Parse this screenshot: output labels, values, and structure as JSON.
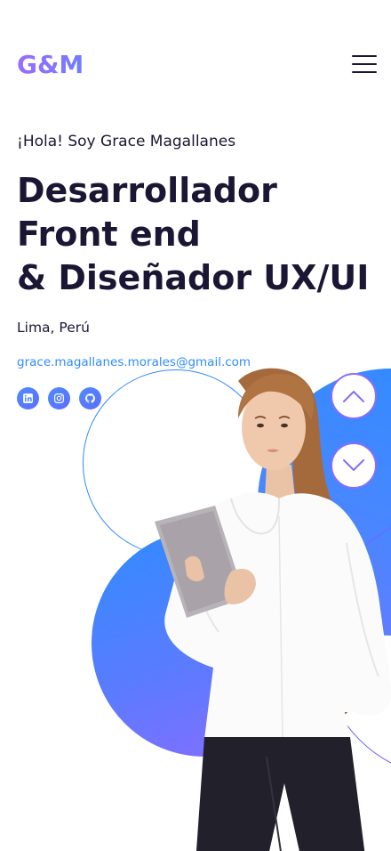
{
  "header": {
    "logo": "G&M",
    "menu_icon": "hamburger-menu-icon"
  },
  "intro": {
    "greeting": "¡Hola! Soy Grace Magallanes",
    "headline": [
      "Desarrollador",
      "Front end",
      "& Diseñador UX/UI"
    ],
    "location": "Lima, Perú",
    "email": "grace.magallanes.morales@gmail.com"
  },
  "socials": [
    {
      "icon": "linkedin-icon"
    },
    {
      "icon": "instagram-icon"
    },
    {
      "icon": "github-icon"
    }
  ],
  "scroll_controls": {
    "up_icon": "chevron-up-icon",
    "down_icon": "chevron-down-icon"
  },
  "colors": {
    "primary_text": "#1b1633",
    "accent_blue": "#2f8cff",
    "accent_purple": "#8a6cff"
  }
}
